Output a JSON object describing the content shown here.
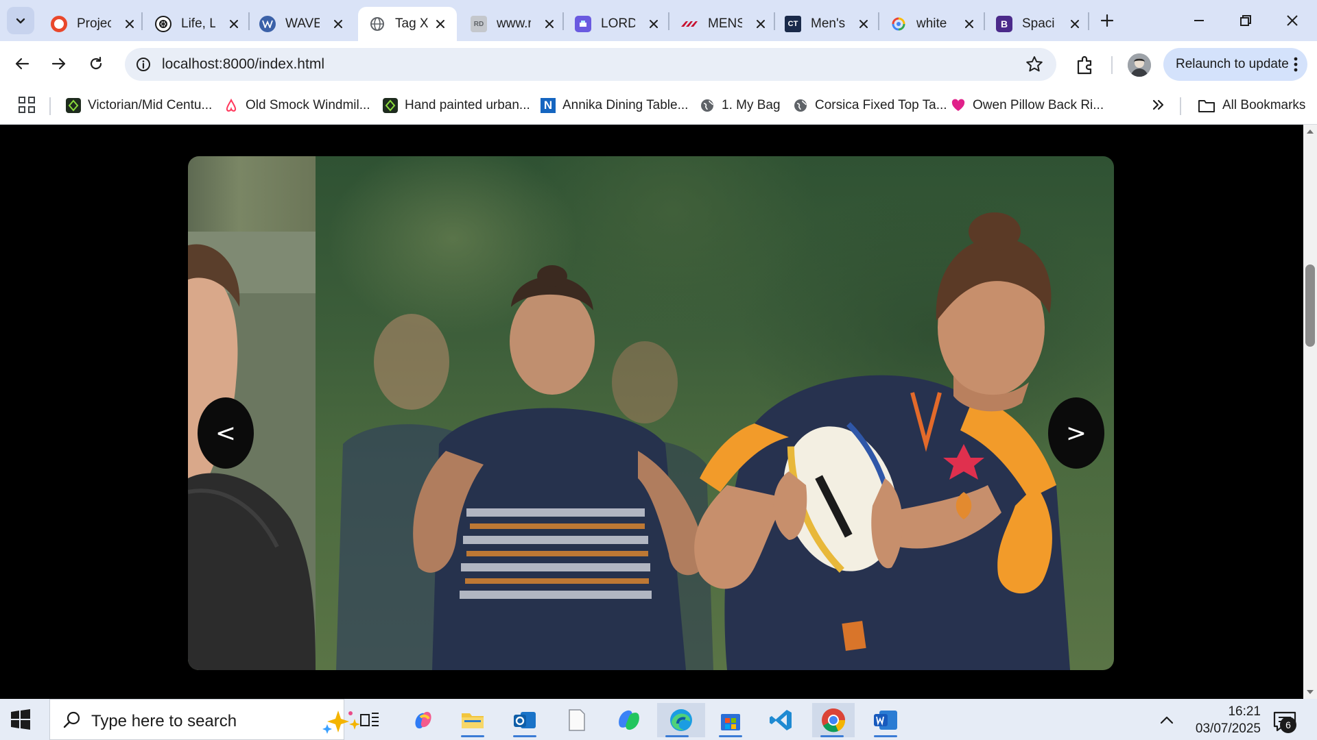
{
  "browser": {
    "tabs": [
      {
        "title": "Projec",
        "favicon": "opera-icon",
        "color": "#e9472b",
        "active": false
      },
      {
        "title": "Life, L",
        "favicon": "openai-icon",
        "color": "#1b1b1b",
        "active": false
      },
      {
        "title": "WAVE",
        "favicon": "wordpress-icon",
        "color": "#3b61a8",
        "active": false
      },
      {
        "title": "Tag X",
        "favicon": "globe-icon",
        "color": "#5f6368",
        "active": true
      },
      {
        "title": "www.r",
        "favicon": "rd-icon",
        "color": "#9aa0a6",
        "active": false
      },
      {
        "title": "LORD",
        "favicon": "printer-icon",
        "color": "#6a5ae0",
        "active": false
      },
      {
        "title": "MENS",
        "favicon": "canterbury-icon",
        "color": "#c8102e",
        "active": false
      },
      {
        "title": "Men's",
        "favicon": "ct-icon",
        "color": "#1a2a4a",
        "active": false
      },
      {
        "title": "white",
        "favicon": "google-lens-icon",
        "color": "#4285f4",
        "active": false
      },
      {
        "title": "Spaci",
        "favicon": "bootstrap-icon",
        "color": "#7b2fbf",
        "active": false
      }
    ],
    "tab_labels": {
      "t0": "Projec",
      "t1": "Life, L",
      "t2": "WAVE",
      "t3": "Tag X",
      "t4": "www.r",
      "t5": "LORD",
      "t6": "MENS",
      "t7": "Men's",
      "t8": "white",
      "t9": "Spaci"
    },
    "favicon_text": {
      "rd": "RD",
      "ct": "CT",
      "b": "B"
    },
    "url": "localhost:8000/index.html",
    "relaunch_label": "Relaunch to update",
    "accent_color": "#d4e2fb"
  },
  "bookmarks": {
    "items": [
      {
        "label": "Victorian/Mid Centu...",
        "icon": "leaf-icon"
      },
      {
        "label": "Old Smock Windmil...",
        "icon": "airbnb-icon"
      },
      {
        "label": "Hand painted urban...",
        "icon": "leaf-icon"
      },
      {
        "label": "Annika Dining Table...",
        "icon": "n-icon"
      },
      {
        "label": "1. My Bag",
        "icon": "globe-icon"
      },
      {
        "label": "Corsica Fixed Top Ta...",
        "icon": "globe-icon"
      },
      {
        "label": "Owen Pillow Back Ri...",
        "icon": "heart-icon"
      }
    ],
    "b0": "Victorian/Mid Centu...",
    "b1": "Old Smock Windmil...",
    "b2": "Hand painted urban...",
    "b3": "Annika Dining Table...",
    "b4": "1. My Bag",
    "b5": "Corsica Fixed Top Ta...",
    "b6": "Owen Pillow Back Ri...",
    "all_bookmarks_label": "All Bookmarks",
    "n_glyph": "N"
  },
  "page": {
    "prev_arrow": "<",
    "next_arrow": ">",
    "slide_subject": "rugby-player-photo"
  },
  "taskbar": {
    "search_placeholder": "Type here to search",
    "time": "16:21",
    "date": "03/07/2025",
    "notification_count": "6",
    "pinned_apps": [
      "task-view-icon",
      "copilot-icon",
      "file-explorer-icon",
      "outlook-icon",
      "notepad-icon",
      "m365-icon",
      "edge-icon",
      "store-icon",
      "vscode-icon",
      "chrome-icon",
      "word-icon"
    ]
  }
}
